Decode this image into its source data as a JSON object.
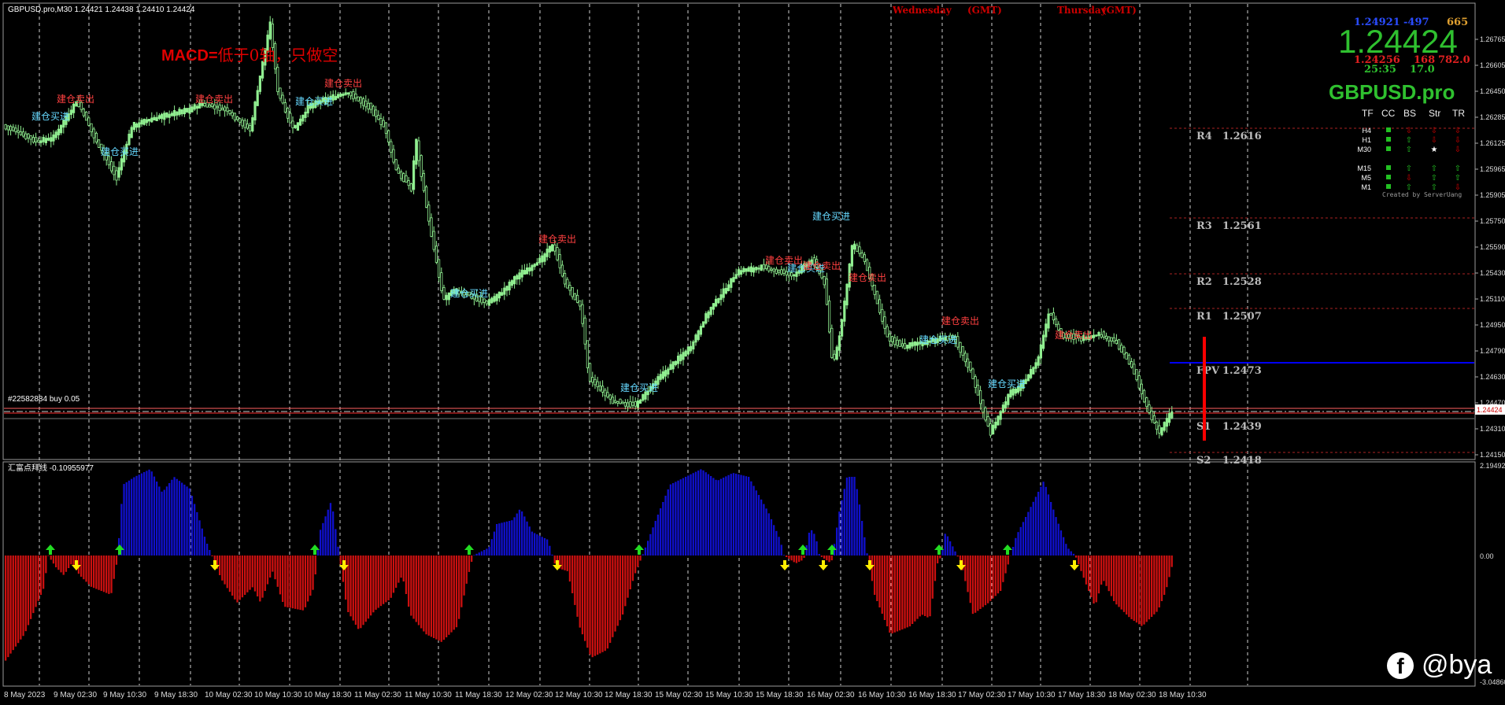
{
  "header": {
    "symbol_info": "GBPUSD.pro,M30  1.24421 1.24438 1.24410 1.24424",
    "session1": "Wednesday",
    "session1_tz": "(GMT)",
    "session2": "Thursday",
    "session2_tz": "(GMT)",
    "macd_note_prefix": "MACD=",
    "macd_note_rest": "低于0轴，只做空"
  },
  "order_label": "#22582884 buy 0.05",
  "indicator_label": "汇富点拜线 -0.10955977",
  "price_panel": {
    "bid": "1.24921",
    "change": "-497",
    "val": "665",
    "big_price": "1.24424",
    "low": "1.24256",
    "spread": "168",
    "range": "782.0",
    "timer": "25:35",
    "pips": "17.0",
    "symbol": "GBPUSD.pro",
    "headers": [
      "TF",
      "CC",
      "BS",
      "Str",
      "TR"
    ],
    "rows": [
      {
        "tf": "H4",
        "bs": "⇩",
        "str": "⇩",
        "tr": "⇩",
        "bs_c": "#d00000",
        "str_c": "#d00000",
        "tr_c": "#d00000"
      },
      {
        "tf": "H1",
        "bs": "⇧",
        "str": "⇩",
        "tr": "⇩",
        "bs_c": "#22c022",
        "str_c": "#d00000",
        "tr_c": "#d00000"
      },
      {
        "tf": "M30",
        "bs": "⇧",
        "str": "★",
        "tr": "⇩",
        "bs_c": "#22c022",
        "str_c": "#ffffff",
        "tr_c": "#d00000"
      },
      {
        "tf": "M15",
        "bs": "⇧",
        "str": "⇧",
        "tr": "⇧",
        "bs_c": "#22c022",
        "str_c": "#22c022",
        "tr_c": "#22c022"
      },
      {
        "tf": "M5",
        "bs": "⇩",
        "str": "⇧",
        "tr": "⇧",
        "bs_c": "#d00000",
        "str_c": "#22c022",
        "tr_c": "#22c022"
      },
      {
        "tf": "M1",
        "bs": "⇧",
        "str": "⇧",
        "tr": "⇩",
        "bs_c": "#22c022",
        "str_c": "#22c022",
        "tr_c": "#d00000"
      }
    ],
    "credit": "Created by ServerUang"
  },
  "pivots": [
    {
      "label": "R4",
      "value": "1.2616"
    },
    {
      "label": "R3",
      "value": "1.2561"
    },
    {
      "label": "R2",
      "value": "1.2528"
    },
    {
      "label": "R1",
      "value": "1.2507"
    },
    {
      "label": "FPV",
      "value": "1.2473"
    },
    {
      "label": "S1",
      "value": "1.2439"
    },
    {
      "label": "S2",
      "value": "1.2418"
    }
  ],
  "signals": {
    "buy": "建仓买进",
    "sell": "建仓卖出"
  },
  "price_axis": [
    "1.26765",
    "1.26605",
    "1.26450",
    "1.26285",
    "1.26125",
    "1.25965",
    "1.25905",
    "1.25750",
    "1.25590",
    "1.25430",
    "1.25110",
    "1.24950",
    "1.24790",
    "1.24630",
    "1.24470",
    "1.24310",
    "1.24150"
  ],
  "current_price_tag": "1.24424",
  "indicator_axis": [
    "2.194920",
    "0.00",
    "-3.04860"
  ],
  "time_axis": [
    "8 May 2023",
    "9 May 02:30",
    "9 May 10:30",
    "9 May 18:30",
    "10 May 02:30",
    "10 May 10:30",
    "10 May 18:30",
    "11 May 02:30",
    "11 May 10:30",
    "11 May 18:30",
    "12 May 02:30",
    "12 May 10:30",
    "12 May 18:30",
    "15 May 02:30",
    "15 May 10:30",
    "15 May 18:30",
    "16 May 02:30",
    "16 May 10:30",
    "16 May 18:30",
    "17 May 02:30",
    "17 May 10:30",
    "17 May 18:30",
    "18 May 02:30",
    "18 May 10:30"
  ],
  "watermark": "@bya",
  "colors": {
    "bull": "#90ee90",
    "bear": "#d00000",
    "hist_pos": "#1010cc",
    "hist_neg": "#cc1010",
    "buy_text": "#66d9ff",
    "sell_text": "#ff4040",
    "pivot_line": "#0000ff"
  }
}
